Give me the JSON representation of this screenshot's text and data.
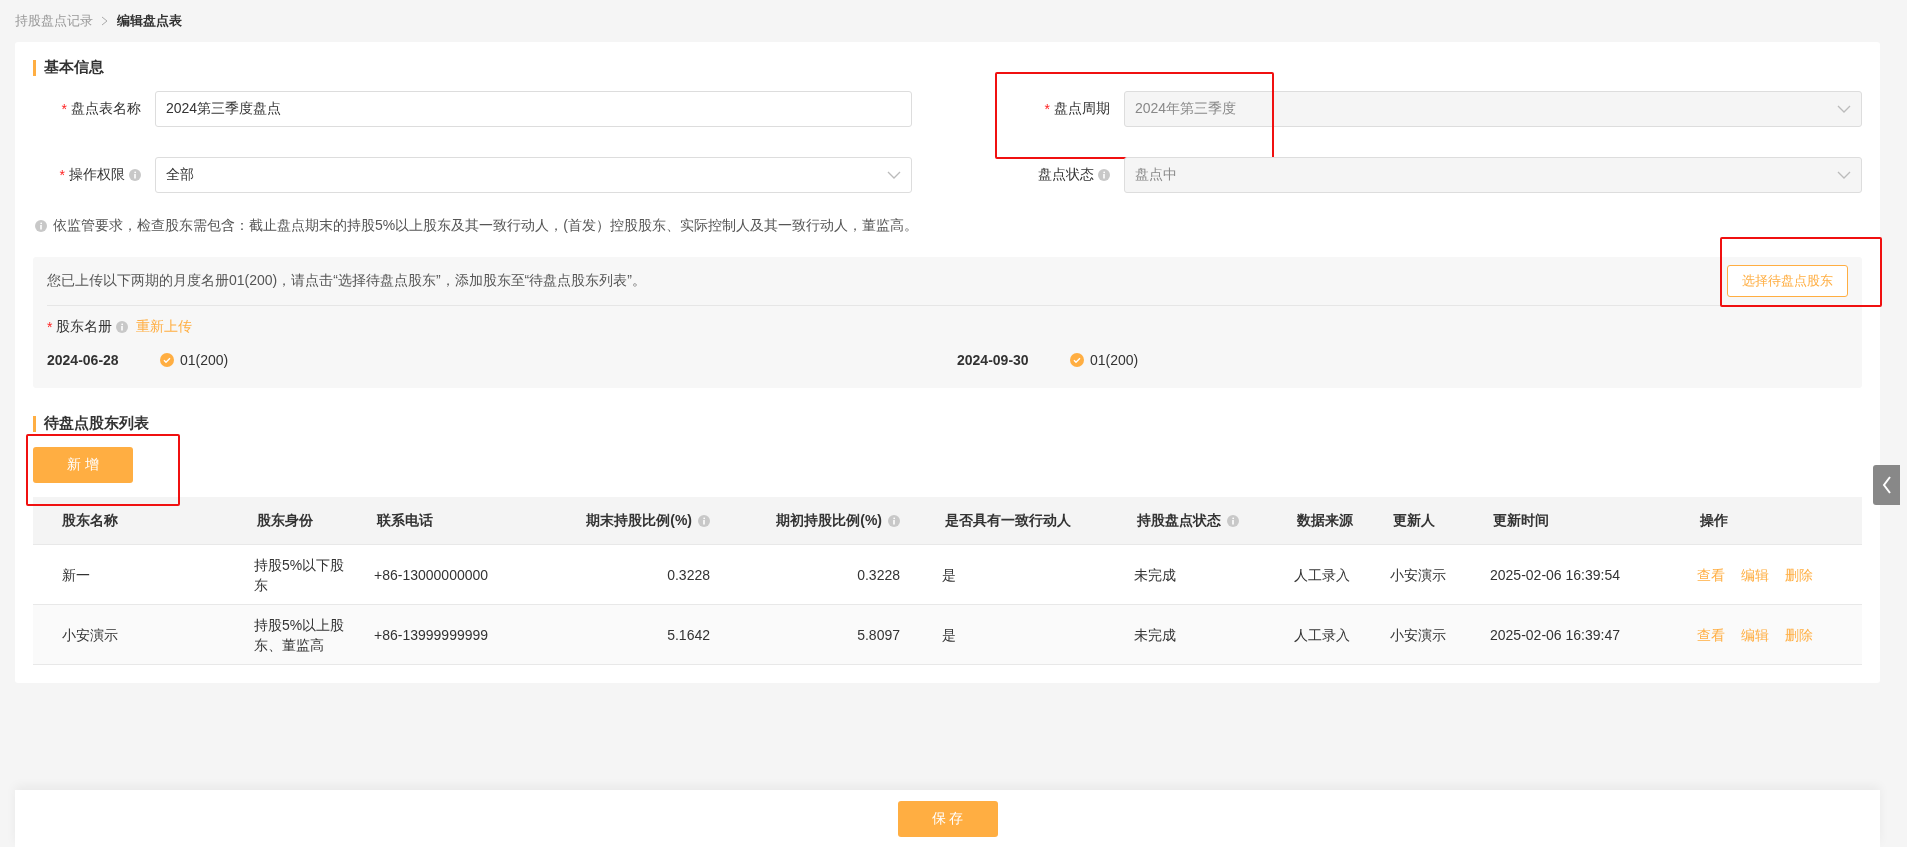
{
  "breadcrumb": [
    {
      "label": "持股盘点记录",
      "current": false
    },
    {
      "label": "编辑盘点表",
      "current": true
    }
  ],
  "basic_info": {
    "title": "基本信息",
    "fields": [
      {
        "label": "盘点表名称",
        "required_mark": "*",
        "info": false,
        "kind": "input",
        "value": "2024第三季度盘点",
        "disabled": false,
        "highlighted": false
      },
      {
        "label": "盘点周期",
        "required_mark": "*",
        "info": false,
        "kind": "select",
        "value": "2024年第三季度",
        "disabled": true,
        "highlighted": true
      },
      {
        "label": "操作权限",
        "required_mark": "*",
        "info": true,
        "kind": "select",
        "value": "全部",
        "disabled": false,
        "highlighted": false
      },
      {
        "label": "盘点状态",
        "info": true,
        "kind": "select",
        "value": "盘点中",
        "disabled": true,
        "highlighted": false
      }
    ],
    "notice": "依监管要求，检查股东需包含：截止盘点期末的持股5%以上股东及其一致行动人，(首发）控股股东、实际控制人及其一致行动人，董监高。"
  },
  "roster_panel": {
    "message": "您已上传以下两期的月度名册01(200)，请点击“选择待盘点股东”，添加股东至“待盘点股东列表”。",
    "select_button": {
      "label": "选择待盘点股东",
      "highlighted": true
    },
    "roster_label": "股东名册",
    "required_mark": "*",
    "reupload_link": "重新上传",
    "periods": [
      {
        "date": "2024-06-28",
        "file": "01(200)"
      },
      {
        "date": "2024-09-30",
        "file": "01(200)"
      }
    ]
  },
  "list_section": {
    "title": "待盘点股东列表",
    "add_button": {
      "label": "新 增",
      "highlighted": true
    },
    "table": {
      "columns": [
        {
          "label": "股东名称",
          "info": false,
          "kind": "text"
        },
        {
          "label": "股东身份",
          "info": false,
          "kind": "text"
        },
        {
          "label": "联系电话",
          "info": false,
          "kind": "text"
        },
        {
          "label": "期末持股比例(%)",
          "info": true,
          "kind": "number"
        },
        {
          "label": "期初持股比例(%)",
          "info": true,
          "kind": "number"
        },
        {
          "label": "是否具有一致行动人",
          "info": false,
          "kind": "text"
        },
        {
          "label": "持股盘点状态",
          "info": true,
          "kind": "text"
        },
        {
          "label": "数据来源",
          "info": false,
          "kind": "text"
        },
        {
          "label": "更新人",
          "info": false,
          "kind": "text"
        },
        {
          "label": "更新时间",
          "info": false,
          "kind": "text"
        },
        {
          "label": "操作",
          "info": false,
          "kind": "text"
        }
      ],
      "rows": [
        {
          "cells": [
            "新一",
            "持股5%以下股东",
            "+86-13000000000",
            "0.3228",
            "0.3228",
            "是",
            "未完成",
            "人工录入",
            "小安演示",
            "2025-02-06 16:39:54"
          ],
          "actions": [
            "查看",
            "编辑",
            "删除"
          ]
        },
        {
          "cells": [
            "小安演示",
            "持股5%以上股东、董监高",
            "+86-13999999999",
            "5.1642",
            "5.8097",
            "是",
            "未完成",
            "人工录入",
            "小安演示",
            "2025-02-06 16:39:47"
          ],
          "actions": [
            "查看",
            "编辑",
            "删除"
          ]
        }
      ]
    }
  },
  "footer": {
    "save_button": "保 存"
  }
}
